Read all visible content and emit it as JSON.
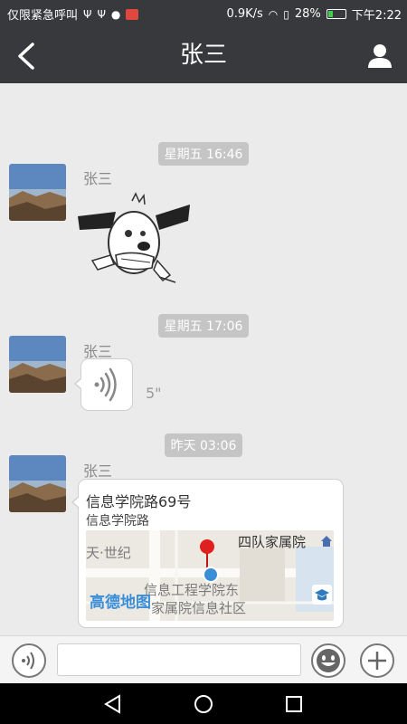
{
  "status_bar": {
    "carrier_text": "仅限紧急呼叫",
    "net_speed": "0.9K/s",
    "battery": "28%",
    "battery_level": 0.28,
    "time": "下午2:22"
  },
  "header": {
    "title": "张三",
    "back_icon": "back-chevron-icon",
    "profile_icon": "user-icon"
  },
  "messages": [
    {
      "time": "星期五 16:46",
      "sender": "张三",
      "type": "sticker"
    },
    {
      "time": "星期五 17:06",
      "sender": "张三",
      "type": "voice",
      "duration": "5\""
    },
    {
      "time": "昨天 03:06",
      "sender": "张三",
      "type": "location",
      "location": {
        "title": "信息学院路69号",
        "subtitle": "信息学院路",
        "map_labels": [
          "四队家属院",
          "信息工程学院东",
          "家属院信息社区",
          "天·世纪"
        ],
        "map_provider": "高德地图"
      }
    }
  ],
  "input_bar": {
    "value": "",
    "placeholder": ""
  },
  "colors": {
    "bar_bg": "#37393c",
    "chat_bg": "#ebebeb",
    "chip_bg": "#c5c5c5",
    "pin_red": "#e02020",
    "map_blue": "#3a8ed8"
  }
}
